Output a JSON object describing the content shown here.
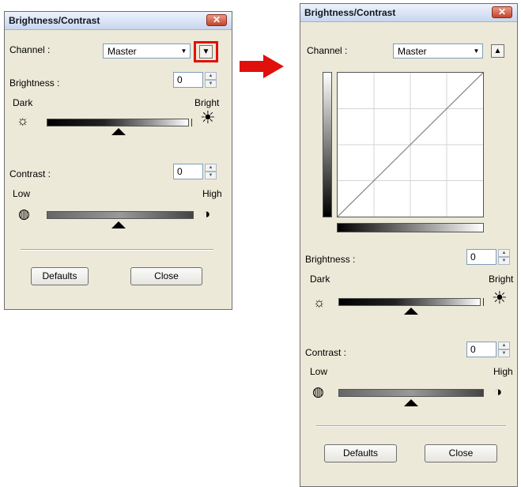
{
  "left_window": {
    "title": "Brightness/Contrast",
    "close_glyph": "✕",
    "channel_label": "Channel :",
    "channel_value": "Master",
    "toggle_glyph": "▼",
    "brightness_label": "Brightness :",
    "brightness_value": "0",
    "dark_label": "Dark",
    "bright_label": "Bright",
    "contrast_label": "Contrast :",
    "contrast_value": "0",
    "low_label": "Low",
    "high_label": "High",
    "defaults_label": "Defaults",
    "close_label": "Close"
  },
  "right_window": {
    "title": "Brightness/Contrast",
    "close_glyph": "✕",
    "channel_label": "Channel :",
    "channel_value": "Master",
    "toggle_glyph": "▲",
    "brightness_label": "Brightness :",
    "brightness_value": "0",
    "dark_label": "Dark",
    "bright_label": "Bright",
    "contrast_label": "Contrast :",
    "contrast_value": "0",
    "low_label": "Low",
    "high_label": "High",
    "defaults_label": "Defaults",
    "close_label": "Close"
  },
  "icons": {
    "dim_sun": "☼",
    "bright_sun": "☀",
    "low_contrast": "◍",
    "high_contrast": "◑",
    "spin_up": "▲",
    "spin_down": "▼",
    "combo_arrow": "▼"
  },
  "colors": {
    "highlight_red": "#e0100d",
    "window_bg": "#ece9d8",
    "titlebar_blue": "#c7d6ee"
  }
}
